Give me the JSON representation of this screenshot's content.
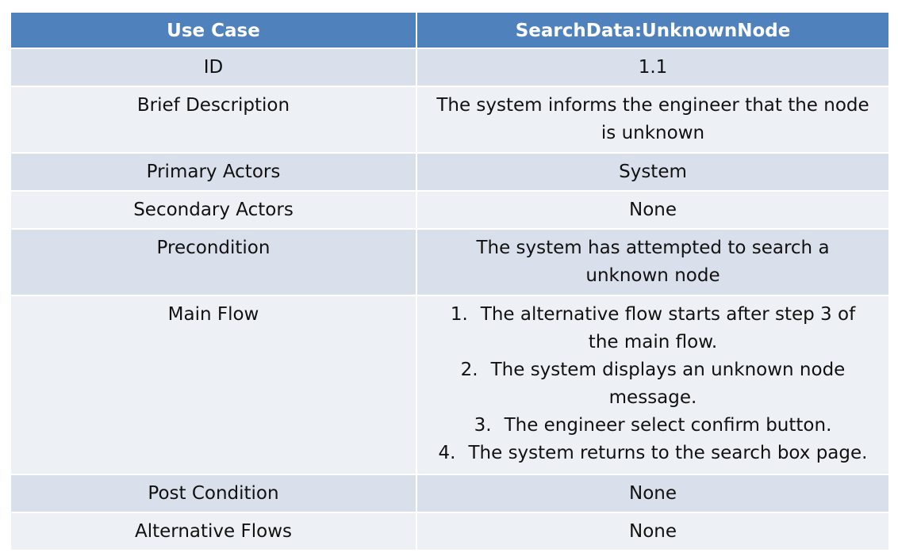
{
  "header": {
    "col1": "Use Case",
    "col2": "SearchData:UnknownNode"
  },
  "rows": {
    "id": {
      "label": "ID",
      "value": "1.1"
    },
    "brief": {
      "label": "Brief Description",
      "value_line1": "The system informs the engineer that the node",
      "value_line2": "is unknown"
    },
    "primary": {
      "label": "Primary Actors",
      "value": "System"
    },
    "secondary": {
      "label": "Secondary Actors",
      "value": "None"
    },
    "precondition": {
      "label": "Precondition",
      "value_line1": "The system has attempted to search a",
      "value_line2": "unknown node"
    },
    "main_flow": {
      "label": "Main Flow",
      "steps": [
        {
          "num": "1.",
          "line1": "The alternative flow starts after step 3 of",
          "line2": "the main flow."
        },
        {
          "num": "2.",
          "line1": "The system displays an unknown node",
          "line2": "message."
        },
        {
          "num": "3.",
          "line1": "The engineer select confirm button.",
          "line2": ""
        },
        {
          "num": "4.",
          "line1": "The system returns to the search box page.",
          "line2": ""
        }
      ]
    },
    "post": {
      "label": "Post Condition",
      "value": "None"
    },
    "alt": {
      "label": "Alternative Flows",
      "value": "None"
    }
  },
  "colors": {
    "header_bg": "#4f81bd",
    "row_dark": "#d9dfeb",
    "row_light": "#edf1f6"
  }
}
